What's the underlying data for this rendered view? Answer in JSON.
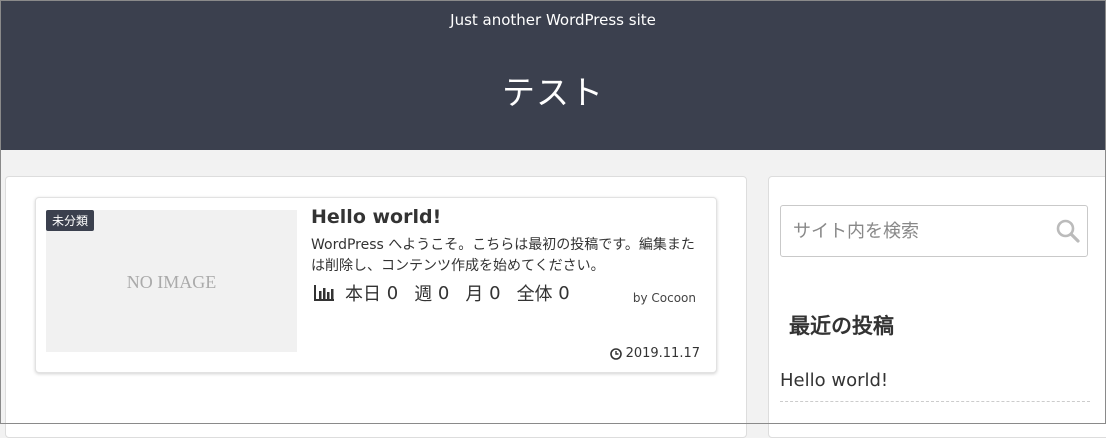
{
  "header": {
    "tagline": "Just another WordPress site",
    "site_name": "テスト",
    "bg_color": "#3b404e"
  },
  "post": {
    "category": "未分類",
    "thumbnail_text": "NO IMAGE",
    "title": "Hello world!",
    "snippet": "WordPress へようこそ。こちらは最初の投稿です。編集または削除し、コンテンツ作成を始めてください。",
    "stats": {
      "icon": "bar-chart-icon",
      "today_label": "本日",
      "today": "0",
      "week_label": "週",
      "week": "0",
      "month_label": "月",
      "month": "0",
      "total_label": "全体",
      "total": "0"
    },
    "author": "by Cocoon",
    "date": "2019.11.17",
    "date_icon": "clock-icon"
  },
  "sidebar": {
    "search": {
      "placeholder": "サイト内を検索",
      "value": "",
      "icon": "search-icon"
    },
    "recent_posts": {
      "title": "最近の投稿",
      "items": [
        "Hello world!"
      ]
    }
  }
}
